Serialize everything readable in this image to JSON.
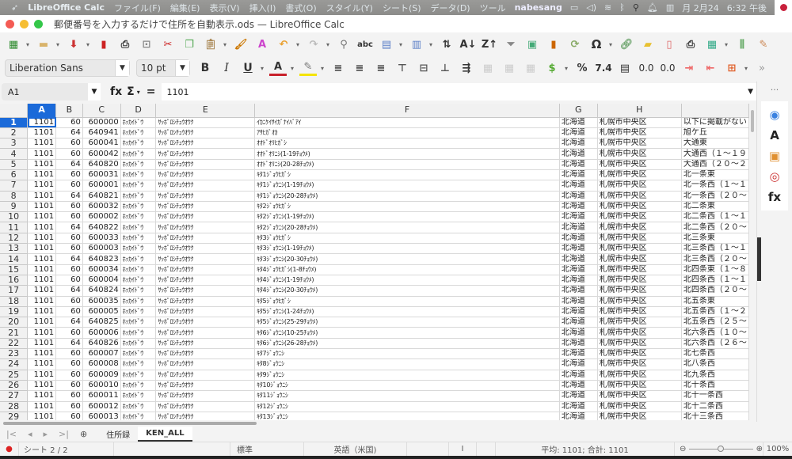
{
  "menubar": {
    "app": "LibreOffice Calc",
    "items": [
      "ファイル(F)",
      "編集(E)",
      "表示(V)",
      "挿入(I)",
      "書式(O)",
      "スタイル(Y)",
      "シート(S)",
      "データ(D)",
      "ツール"
    ],
    "user": "nabesang",
    "date": "月 2月24",
    "time": "6:32 午後"
  },
  "window": {
    "title": "郵便番号を入力するだけで住所を自動表示.ods — LibreOffice Calc"
  },
  "toolbar2": {
    "font_name": "Liberation Sans",
    "font_size": "10 pt",
    "percent": "%",
    "number": "7.4",
    "add_decimal": "0.0",
    "del_decimal": "0.0"
  },
  "formula_bar": {
    "cell_ref": "A1",
    "fx": "fx",
    "sum": "Σ",
    "equals": "=",
    "value": "1101"
  },
  "columns": [
    "A",
    "B",
    "C",
    "D",
    "E",
    "F",
    "G",
    "H",
    ""
  ],
  "rows": [
    {
      "n": "1",
      "a": "1101",
      "b": "60",
      "c": "600000",
      "d": "ﾎｯｶｲﾄﾞｳ",
      "e": "ｻｯﾎﾟﾛｼﾁｭｳｵｳｸ",
      "f": "ｲｶﾆｹｲｻｲｶﾞﾅｲﾊﾞｱｲ",
      "g": "北海道",
      "h": "札幌市中央区",
      "i": "以下に掲載がない"
    },
    {
      "n": "2",
      "a": "1101",
      "b": "64",
      "c": "640941",
      "d": "ﾎｯｶｲﾄﾞｳ",
      "e": "ｻｯﾎﾟﾛｼﾁｭｳｵｳｸ",
      "f": "ｱｻﾋｶﾞｵｶ",
      "g": "北海道",
      "h": "札幌市中央区",
      "i": "旭ケ丘"
    },
    {
      "n": "3",
      "a": "1101",
      "b": "60",
      "c": "600041",
      "d": "ﾎｯｶｲﾄﾞｳ",
      "e": "ｻｯﾎﾟﾛｼﾁｭｳｵｳｸ",
      "f": "ｵｵﾄﾞｵﾘﾋｶﾞｼ",
      "g": "北海道",
      "h": "札幌市中央区",
      "i": "大通東"
    },
    {
      "n": "4",
      "a": "1101",
      "b": "60",
      "c": "600042",
      "d": "ﾎｯｶｲﾄﾞｳ",
      "e": "ｻｯﾎﾟﾛｼﾁｭｳｵｳｸ",
      "f": "ｵｵﾄﾞｵﾘﾆｼ(1-19ﾁｮｳﾒ)",
      "g": "北海道",
      "h": "札幌市中央区",
      "i": "大通西（１～１９"
    },
    {
      "n": "5",
      "a": "1101",
      "b": "64",
      "c": "640820",
      "d": "ﾎｯｶｲﾄﾞｳ",
      "e": "ｻｯﾎﾟﾛｼﾁｭｳｵｳｸ",
      "f": "ｵｵﾄﾞｵﾘﾆｼ(20-28ﾁｮｳﾒ)",
      "g": "北海道",
      "h": "札幌市中央区",
      "i": "大通西（２０～２"
    },
    {
      "n": "6",
      "a": "1101",
      "b": "60",
      "c": "600031",
      "d": "ﾎｯｶｲﾄﾞｳ",
      "e": "ｻｯﾎﾟﾛｼﾁｭｳｵｳｸ",
      "f": "ｷﾀ1ｼﾞｮｳﾋｶﾞｼ",
      "g": "北海道",
      "h": "札幌市中央区",
      "i": "北一条東"
    },
    {
      "n": "7",
      "a": "1101",
      "b": "60",
      "c": "600001",
      "d": "ﾎｯｶｲﾄﾞｳ",
      "e": "ｻｯﾎﾟﾛｼﾁｭｳｵｳｸ",
      "f": "ｷﾀ1ｼﾞｮｳﾆｼ(1-19ﾁｮｳﾒ)",
      "g": "北海道",
      "h": "札幌市中央区",
      "i": "北一条西（１～１"
    },
    {
      "n": "8",
      "a": "1101",
      "b": "64",
      "c": "640821",
      "d": "ﾎｯｶｲﾄﾞｳ",
      "e": "ｻｯﾎﾟﾛｼﾁｭｳｵｳｸ",
      "f": "ｷﾀ1ｼﾞｮｳﾆｼ(20-28ﾁｮｳﾒ)",
      "g": "北海道",
      "h": "札幌市中央区",
      "i": "北一条西（２０～"
    },
    {
      "n": "9",
      "a": "1101",
      "b": "60",
      "c": "600032",
      "d": "ﾎｯｶｲﾄﾞｳ",
      "e": "ｻｯﾎﾟﾛｼﾁｭｳｵｳｸ",
      "f": "ｷﾀ2ｼﾞｮｳﾋｶﾞｼ",
      "g": "北海道",
      "h": "札幌市中央区",
      "i": "北二条東"
    },
    {
      "n": "10",
      "a": "1101",
      "b": "60",
      "c": "600002",
      "d": "ﾎｯｶｲﾄﾞｳ",
      "e": "ｻｯﾎﾟﾛｼﾁｭｳｵｳｸ",
      "f": "ｷﾀ2ｼﾞｮｳﾆｼ(1-19ﾁｮｳﾒ)",
      "g": "北海道",
      "h": "札幌市中央区",
      "i": "北二条西（１～１"
    },
    {
      "n": "11",
      "a": "1101",
      "b": "64",
      "c": "640822",
      "d": "ﾎｯｶｲﾄﾞｳ",
      "e": "ｻｯﾎﾟﾛｼﾁｭｳｵｳｸ",
      "f": "ｷﾀ2ｼﾞｮｳﾆｼ(20-28ﾁｮｳﾒ)",
      "g": "北海道",
      "h": "札幌市中央区",
      "i": "北二条西（２０～"
    },
    {
      "n": "12",
      "a": "1101",
      "b": "60",
      "c": "600033",
      "d": "ﾎｯｶｲﾄﾞｳ",
      "e": "ｻｯﾎﾟﾛｼﾁｭｳｵｳｸ",
      "f": "ｷﾀ3ｼﾞｮｳﾋｶﾞｼ",
      "g": "北海道",
      "h": "札幌市中央区",
      "i": "北三条東"
    },
    {
      "n": "13",
      "a": "1101",
      "b": "60",
      "c": "600003",
      "d": "ﾎｯｶｲﾄﾞｳ",
      "e": "ｻｯﾎﾟﾛｼﾁｭｳｵｳｸ",
      "f": "ｷﾀ3ｼﾞｮｳﾆｼ(1-19ﾁｮｳﾒ)",
      "g": "北海道",
      "h": "札幌市中央区",
      "i": "北三条西（１～１"
    },
    {
      "n": "14",
      "a": "1101",
      "b": "64",
      "c": "640823",
      "d": "ﾎｯｶｲﾄﾞｳ",
      "e": "ｻｯﾎﾟﾛｼﾁｭｳｵｳｸ",
      "f": "ｷﾀ3ｼﾞｮｳﾆｼ(20-30ﾁｮｳﾒ)",
      "g": "北海道",
      "h": "札幌市中央区",
      "i": "北三条西（２０～"
    },
    {
      "n": "15",
      "a": "1101",
      "b": "60",
      "c": "600034",
      "d": "ﾎｯｶｲﾄﾞｳ",
      "e": "ｻｯﾎﾟﾛｼﾁｭｳｵｳｸ",
      "f": "ｷﾀ4ｼﾞｮｳﾋｶﾞｼ(1-8ﾁｮｳﾒ)",
      "g": "北海道",
      "h": "札幌市中央区",
      "i": "北四条東（１～８"
    },
    {
      "n": "16",
      "a": "1101",
      "b": "60",
      "c": "600004",
      "d": "ﾎｯｶｲﾄﾞｳ",
      "e": "ｻｯﾎﾟﾛｼﾁｭｳｵｳｸ",
      "f": "ｷﾀ4ｼﾞｮｳﾆｼ(1-19ﾁｮｳﾒ)",
      "g": "北海道",
      "h": "札幌市中央区",
      "i": "北四条西（１～１"
    },
    {
      "n": "17",
      "a": "1101",
      "b": "64",
      "c": "640824",
      "d": "ﾎｯｶｲﾄﾞｳ",
      "e": "ｻｯﾎﾟﾛｼﾁｭｳｵｳｸ",
      "f": "ｷﾀ4ｼﾞｮｳﾆｼ(20-30ﾁｮｳﾒ)",
      "g": "北海道",
      "h": "札幌市中央区",
      "i": "北四条西（２０～"
    },
    {
      "n": "18",
      "a": "1101",
      "b": "60",
      "c": "600035",
      "d": "ﾎｯｶｲﾄﾞｳ",
      "e": "ｻｯﾎﾟﾛｼﾁｭｳｵｳｸ",
      "f": "ｷﾀ5ｼﾞｮｳﾋｶﾞｼ",
      "g": "北海道",
      "h": "札幌市中央区",
      "i": "北五条東"
    },
    {
      "n": "19",
      "a": "1101",
      "b": "60",
      "c": "600005",
      "d": "ﾎｯｶｲﾄﾞｳ",
      "e": "ｻｯﾎﾟﾛｼﾁｭｳｵｳｸ",
      "f": "ｷﾀ5ｼﾞｮｳﾆｼ(1-24ﾁｮｳﾒ)",
      "g": "北海道",
      "h": "札幌市中央区",
      "i": "北五条西（１～２"
    },
    {
      "n": "20",
      "a": "1101",
      "b": "64",
      "c": "640825",
      "d": "ﾎｯｶｲﾄﾞｳ",
      "e": "ｻｯﾎﾟﾛｼﾁｭｳｵｳｸ",
      "f": "ｷﾀ5ｼﾞｮｳﾆｼ(25-29ﾁｮｳﾒ)",
      "g": "北海道",
      "h": "札幌市中央区",
      "i": "北五条西（２５～"
    },
    {
      "n": "21",
      "a": "1101",
      "b": "60",
      "c": "600006",
      "d": "ﾎｯｶｲﾄﾞｳ",
      "e": "ｻｯﾎﾟﾛｼﾁｭｳｵｳｸ",
      "f": "ｷﾀ6ｼﾞｮｳﾆｼ(10-25ﾁｮｳﾒ)",
      "g": "北海道",
      "h": "札幌市中央区",
      "i": "北六条西（１０～"
    },
    {
      "n": "22",
      "a": "1101",
      "b": "64",
      "c": "640826",
      "d": "ﾎｯｶｲﾄﾞｳ",
      "e": "ｻｯﾎﾟﾛｼﾁｭｳｵｳｸ",
      "f": "ｷﾀ6ｼﾞｮｳﾆｼ(26-28ﾁｮｳﾒ)",
      "g": "北海道",
      "h": "札幌市中央区",
      "i": "北六条西（２６～"
    },
    {
      "n": "23",
      "a": "1101",
      "b": "60",
      "c": "600007",
      "d": "ﾎｯｶｲﾄﾞｳ",
      "e": "ｻｯﾎﾟﾛｼﾁｭｳｵｳｸ",
      "f": "ｷﾀ7ｼﾞｮｳﾆｼ",
      "g": "北海道",
      "h": "札幌市中央区",
      "i": "北七条西"
    },
    {
      "n": "24",
      "a": "1101",
      "b": "60",
      "c": "600008",
      "d": "ﾎｯｶｲﾄﾞｳ",
      "e": "ｻｯﾎﾟﾛｼﾁｭｳｵｳｸ",
      "f": "ｷﾀ8ｼﾞｮｳﾆｼ",
      "g": "北海道",
      "h": "札幌市中央区",
      "i": "北八条西"
    },
    {
      "n": "25",
      "a": "1101",
      "b": "60",
      "c": "600009",
      "d": "ﾎｯｶｲﾄﾞｳ",
      "e": "ｻｯﾎﾟﾛｼﾁｭｳｵｳｸ",
      "f": "ｷﾀ9ｼﾞｮｳﾆｼ",
      "g": "北海道",
      "h": "札幌市中央区",
      "i": "北九条西"
    },
    {
      "n": "26",
      "a": "1101",
      "b": "60",
      "c": "600010",
      "d": "ﾎｯｶｲﾄﾞｳ",
      "e": "ｻｯﾎﾟﾛｼﾁｭｳｵｳｸ",
      "f": "ｷﾀ10ｼﾞｮｳﾆｼ",
      "g": "北海道",
      "h": "札幌市中央区",
      "i": "北十条西"
    },
    {
      "n": "27",
      "a": "1101",
      "b": "60",
      "c": "600011",
      "d": "ﾎｯｶｲﾄﾞｳ",
      "e": "ｻｯﾎﾟﾛｼﾁｭｳｵｳｸ",
      "f": "ｷﾀ11ｼﾞｮｳﾆｼ",
      "g": "北海道",
      "h": "札幌市中央区",
      "i": "北十一条西"
    },
    {
      "n": "28",
      "a": "1101",
      "b": "60",
      "c": "600012",
      "d": "ﾎｯｶｲﾄﾞｳ",
      "e": "ｻｯﾎﾟﾛｼﾁｭｳｵｳｸ",
      "f": "ｷﾀ12ｼﾞｮｳﾆｼ",
      "g": "北海道",
      "h": "札幌市中央区",
      "i": "北十二条西"
    },
    {
      "n": "29",
      "a": "1101",
      "b": "60",
      "c": "600013",
      "d": "ﾎｯｶｲﾄﾞｳ",
      "e": "ｻｯﾎﾟﾛｼﾁｭｳｵｳｸ",
      "f": "ｷﾀ13ｼﾞｮｳﾆｼ",
      "g": "北海道",
      "h": "札幌市中央区",
      "i": "北十三条西"
    }
  ],
  "sheet_tabs": [
    {
      "label": "住所録",
      "active": false
    },
    {
      "label": "KEN_ALL",
      "active": true
    }
  ],
  "status": {
    "sheet": "シート 2 / 2",
    "style": "標準",
    "language": "英語（米国)",
    "summary": "平均: 1101; 合計: 1101",
    "zoom": "100%"
  },
  "sidebar": {
    "more": "···"
  }
}
